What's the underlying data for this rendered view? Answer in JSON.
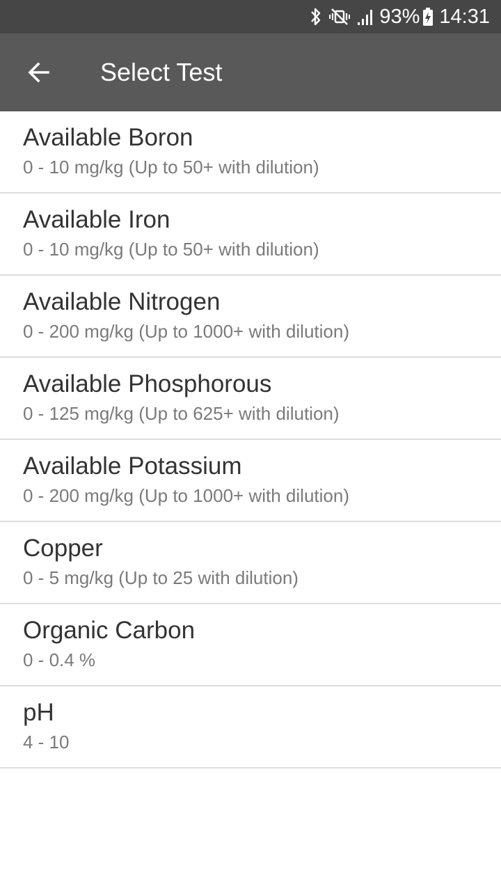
{
  "status_bar": {
    "battery_percent": "93%",
    "time": "14:31",
    "icons": [
      "bluetooth-icon",
      "vibrate-mute-icon",
      "signal-icon",
      "battery-charging-icon"
    ]
  },
  "app_bar": {
    "title": "Select Test",
    "back_icon": "arrow-left-icon"
  },
  "tests": [
    {
      "name": "Available Boron",
      "range": "0 - 10 mg/kg (Up to 50+ with dilution)"
    },
    {
      "name": "Available Iron",
      "range": "0 - 10 mg/kg (Up to 50+ with dilution)"
    },
    {
      "name": "Available Nitrogen",
      "range": "0 - 200 mg/kg (Up to 1000+ with dilution)"
    },
    {
      "name": "Available Phosphorous",
      "range": "0 - 125 mg/kg (Up to 625+ with dilution)"
    },
    {
      "name": "Available Potassium",
      "range": "0 - 200 mg/kg (Up to 1000+ with dilution)"
    },
    {
      "name": "Copper",
      "range": "0 - 5 mg/kg (Up to 25 with dilution)"
    },
    {
      "name": "Organic Carbon",
      "range": "0 - 0.4 %"
    },
    {
      "name": "pH",
      "range": "4 - 10"
    }
  ],
  "colors": {
    "status_bar_bg": "#464646",
    "app_bar_bg": "#595959",
    "title_text": "#ffffff",
    "item_name_text": "#333333",
    "item_range_text": "#7a7a7a",
    "divider": "#dcdcdc"
  }
}
